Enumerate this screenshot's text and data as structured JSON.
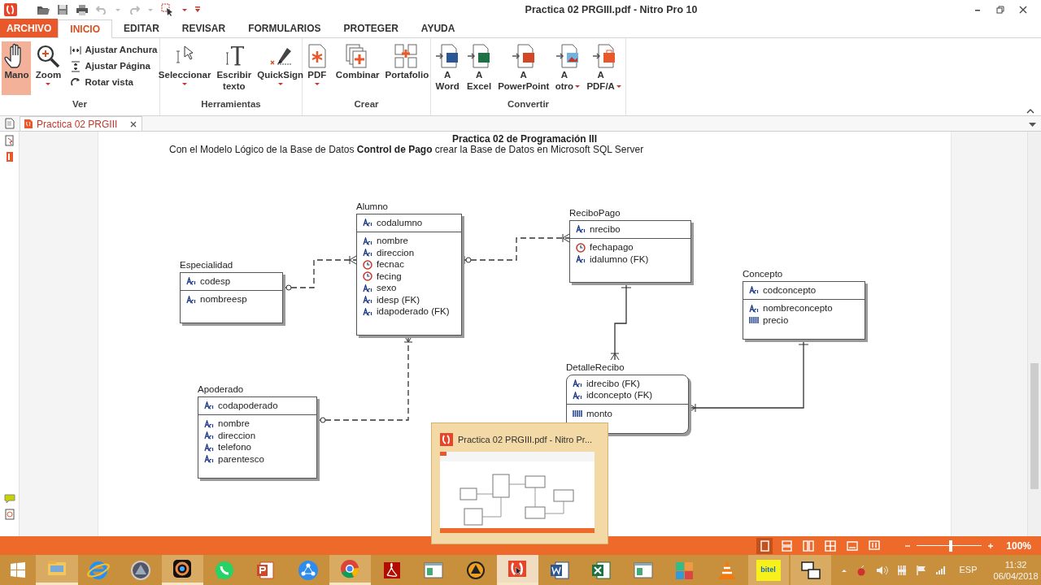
{
  "title_bar": {
    "title": "Practica 02 PRGIII.pdf - Nitro Pro 10"
  },
  "menu_tabs": [
    {
      "label": "ARCHIVO",
      "kind": "file",
      "selected": false
    },
    {
      "label": "INICIO",
      "kind": "tab",
      "selected": true
    },
    {
      "label": "EDITAR",
      "kind": "tab",
      "selected": false
    },
    {
      "label": "REVISAR",
      "kind": "tab",
      "selected": false
    },
    {
      "label": "FORMULARIOS",
      "kind": "tab",
      "selected": false
    },
    {
      "label": "PROTEGER",
      "kind": "tab",
      "selected": false
    },
    {
      "label": "AYUDA",
      "kind": "tab",
      "selected": false
    }
  ],
  "ribbon_groups": [
    {
      "label": "Ver",
      "buttons": [
        {
          "label": "Mano",
          "kind": "large",
          "selected": true,
          "dropdown": false
        },
        {
          "label": "Zoom",
          "kind": "large",
          "selected": false,
          "dropdown": true
        },
        {
          "label": "Ajustar Anchura",
          "kind": "small",
          "selected": false,
          "dropdown": false
        },
        {
          "label": "Ajustar Página",
          "kind": "small",
          "selected": false,
          "dropdown": false
        },
        {
          "label": "Rotar vista",
          "kind": "small",
          "selected": false,
          "dropdown": false
        }
      ]
    },
    {
      "label": "Herramientas",
      "buttons": [
        {
          "label": "Seleccionar",
          "kind": "large",
          "selected": false,
          "dropdown": true
        },
        {
          "label": "Escribir texto",
          "kind": "large",
          "selected": false,
          "dropdown": false
        },
        {
          "label": "QuickSign",
          "kind": "large",
          "selected": false,
          "dropdown": true
        }
      ]
    },
    {
      "label": "Crear",
      "buttons": [
        {
          "label": "PDF",
          "kind": "large",
          "selected": false,
          "dropdown": true
        },
        {
          "label": "Combinar",
          "kind": "large",
          "selected": false,
          "dropdown": false
        },
        {
          "label": "Portafolio",
          "kind": "large",
          "selected": false,
          "dropdown": false
        }
      ]
    },
    {
      "label": "Convertir",
      "buttons": [
        {
          "label": "A Word",
          "kind": "large",
          "selected": false,
          "dropdown": false
        },
        {
          "label": "A Excel",
          "kind": "large",
          "selected": false,
          "dropdown": false
        },
        {
          "label": "A PowerPoint",
          "kind": "large",
          "selected": false,
          "dropdown": false
        },
        {
          "label": "A otro",
          "kind": "large",
          "selected": false,
          "dropdown": true
        },
        {
          "label": "A PDF/A",
          "kind": "large",
          "selected": false,
          "dropdown": true
        }
      ]
    }
  ],
  "document_tabs": [
    {
      "label": "Practica 02 PRGIII",
      "selected": true
    }
  ],
  "document": {
    "heading": "Practica 02 de Programación III",
    "intro": "Con el Modelo Lógico de la Base de Datos **Control de Pago** crear la Base de Datos en Microsoft SQL Server",
    "entities": [
      {
        "name": "Alumno",
        "kind": "independent",
        "keys": [
          {
            "name": "codalumno",
            "kind": "text"
          }
        ],
        "attributes": [
          {
            "name": "nombre",
            "kind": "text"
          },
          {
            "name": "direccion",
            "kind": "text"
          },
          {
            "name": "fecnac",
            "kind": "date"
          },
          {
            "name": "fecing",
            "kind": "date"
          },
          {
            "name": "sexo",
            "kind": "text"
          },
          {
            "name": "idesp (FK)",
            "kind": "text"
          },
          {
            "name": "idapoderado (FK)",
            "kind": "text"
          }
        ]
      },
      {
        "name": "ReciboPago",
        "kind": "independent",
        "keys": [
          {
            "name": "nrecibo",
            "kind": "text"
          }
        ],
        "attributes": [
          {
            "name": "fechapago",
            "kind": "date"
          },
          {
            "name": "idalumno (FK)",
            "kind": "text"
          }
        ]
      },
      {
        "name": "Especialidad",
        "kind": "independent",
        "keys": [
          {
            "name": "codesp",
            "kind": "text"
          }
        ],
        "attributes": [
          {
            "name": "nombreesp",
            "kind": "text"
          }
        ]
      },
      {
        "name": "Concepto",
        "kind": "independent",
        "keys": [
          {
            "name": "codconcepto",
            "kind": "text"
          }
        ],
        "attributes": [
          {
            "name": "nombreconcepto",
            "kind": "text"
          },
          {
            "name": "precio",
            "kind": "number"
          }
        ]
      },
      {
        "name": "DetalleRecibo",
        "kind": "dependent",
        "keys": [
          {
            "name": "idrecibo (FK)",
            "kind": "text"
          },
          {
            "name": "idconcepto (FK)",
            "kind": "text"
          }
        ],
        "attributes": [
          {
            "name": "monto",
            "kind": "number"
          }
        ]
      },
      {
        "name": "Apoderado",
        "kind": "independent",
        "keys": [
          {
            "name": "codapoderado",
            "kind": "text"
          }
        ],
        "attributes": [
          {
            "name": "nombre",
            "kind": "text"
          },
          {
            "name": "direccion",
            "kind": "text"
          },
          {
            "name": "telefono",
            "kind": "text"
          },
          {
            "name": "parentesco",
            "kind": "text"
          }
        ]
      }
    ]
  },
  "taskbar_preview": {
    "title": "Practica 02 PRGIII.pdf - Nitro Pr..."
  },
  "status_bar": {
    "view_modes": [
      {
        "selected": true
      },
      {
        "selected": false
      },
      {
        "selected": false
      },
      {
        "selected": false
      },
      {
        "selected": false
      },
      {
        "selected": false
      }
    ],
    "zoom": {
      "level": 0.52,
      "reading": "100%"
    }
  },
  "taskbar": {
    "apps": [
      {
        "running": true,
        "selected": false
      },
      {
        "running": false,
        "selected": false
      },
      {
        "running": false,
        "selected": false
      },
      {
        "running": true,
        "selected": false
      },
      {
        "running": false,
        "selected": false
      },
      {
        "running": false,
        "selected": false
      },
      {
        "running": false,
        "selected": false
      },
      {
        "running": true,
        "selected": false
      },
      {
        "running": false,
        "selected": false
      },
      {
        "running": false,
        "selected": false
      },
      {
        "running": false,
        "selected": false
      },
      {
        "running": true,
        "selected": true
      },
      {
        "running": false,
        "selected": false
      },
      {
        "running": false,
        "selected": false
      },
      {
        "running": false,
        "selected": false
      },
      {
        "running": false,
        "selected": false
      },
      {
        "running": false,
        "selected": false
      }
    ],
    "bitel_label": "bitel",
    "language": "ESP",
    "time": "11:32",
    "date": "06/04/2018"
  }
}
